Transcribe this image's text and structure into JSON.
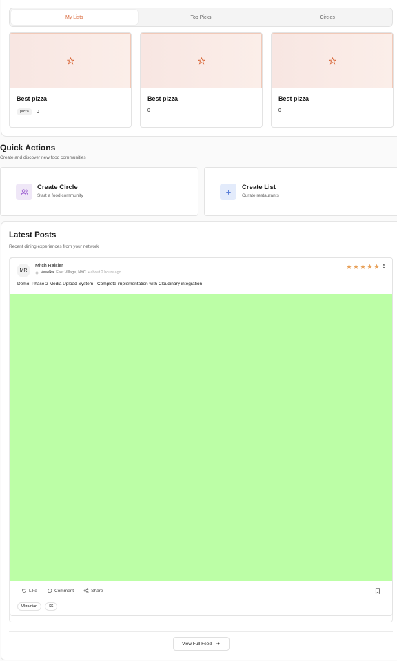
{
  "tabs": [
    {
      "label": "My Lists",
      "active": true
    },
    {
      "label": "Top Picks",
      "active": false
    },
    {
      "label": "Circles",
      "active": false
    }
  ],
  "lists": [
    {
      "title": "Best pizza",
      "tag": "pizza",
      "count": "0",
      "icon": "star-icon"
    },
    {
      "title": "Best pizza",
      "tag": "",
      "count": "0",
      "icon": "star-icon"
    },
    {
      "title": "Best pizza",
      "tag": "",
      "count": "0",
      "icon": "star-icon"
    }
  ],
  "quick_actions": {
    "title": "Quick Actions",
    "subtitle": "Create and discover new food communities",
    "items": [
      {
        "name": "Create Circle",
        "desc": "Start a food community",
        "icon": "users-icon"
      },
      {
        "name": "Create List",
        "desc": "Curate restaurants",
        "icon": "plus-icon"
      }
    ]
  },
  "posts": {
    "title": "Latest Posts",
    "subtitle": "Recent dining experiences from your network",
    "post": {
      "initials": "MR",
      "author": "Mitch Reisler",
      "restaurant": "Veselka",
      "location": "East Village, NYC",
      "time": "• about 2 hours ago",
      "rating": "5",
      "text": "Demo: Phase 2 Media Upload System - Complete implementation with Cloudinary integration",
      "image_color": "#bcfea6",
      "actions": {
        "like": "Like",
        "comment": "Comment",
        "share": "Share"
      },
      "tags": [
        "Ukrainian",
        "$$"
      ]
    },
    "view_feed": "View Full Feed"
  },
  "colors": {
    "accent": "#d9683a",
    "star": "#e8a25c"
  }
}
